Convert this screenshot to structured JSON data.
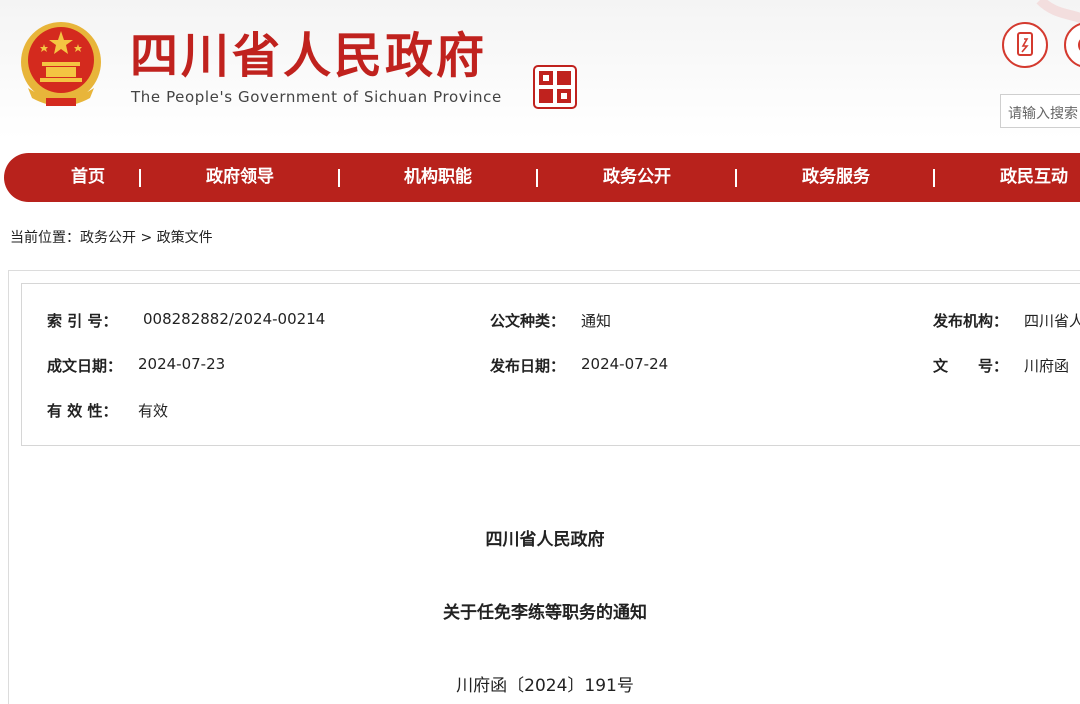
{
  "header": {
    "title_cn": "四川省人民政府",
    "title_en": "The People's Government of Sichuan Province",
    "search_placeholder": "请输入搜索"
  },
  "nav": {
    "items": [
      {
        "label": "首页"
      },
      {
        "label": "政府领导"
      },
      {
        "label": "机构职能"
      },
      {
        "label": "政务公开"
      },
      {
        "label": "政务服务"
      },
      {
        "label": "政民互动"
      }
    ]
  },
  "breadcrumb": {
    "prefix": "当前位置：",
    "parent": "政务公开",
    "separator": " > ",
    "current": "政策文件"
  },
  "meta": {
    "index_label": "索 引 号：",
    "index_value": "008282882/2024-00214",
    "type_label": "公文种类：",
    "type_value": "通知",
    "publisher_label": "发布机构：",
    "publisher_value": "四川省人",
    "created_label": "成文日期：",
    "created_value": "2024-07-23",
    "published_label": "发布日期：",
    "published_value": "2024-07-24",
    "docno_label": "文　　号：",
    "docno_value": "川府函",
    "validity_label": "有 效 性：",
    "validity_value": "有效"
  },
  "document": {
    "issuer": "四川省人民政府",
    "title": "关于任免李练等职务的通知",
    "number": "川府函〔2024〕191号"
  },
  "colors": {
    "brand_red": "#c0221e",
    "nav_red": "#b8221c",
    "emblem_gold": "#e8b53a"
  }
}
